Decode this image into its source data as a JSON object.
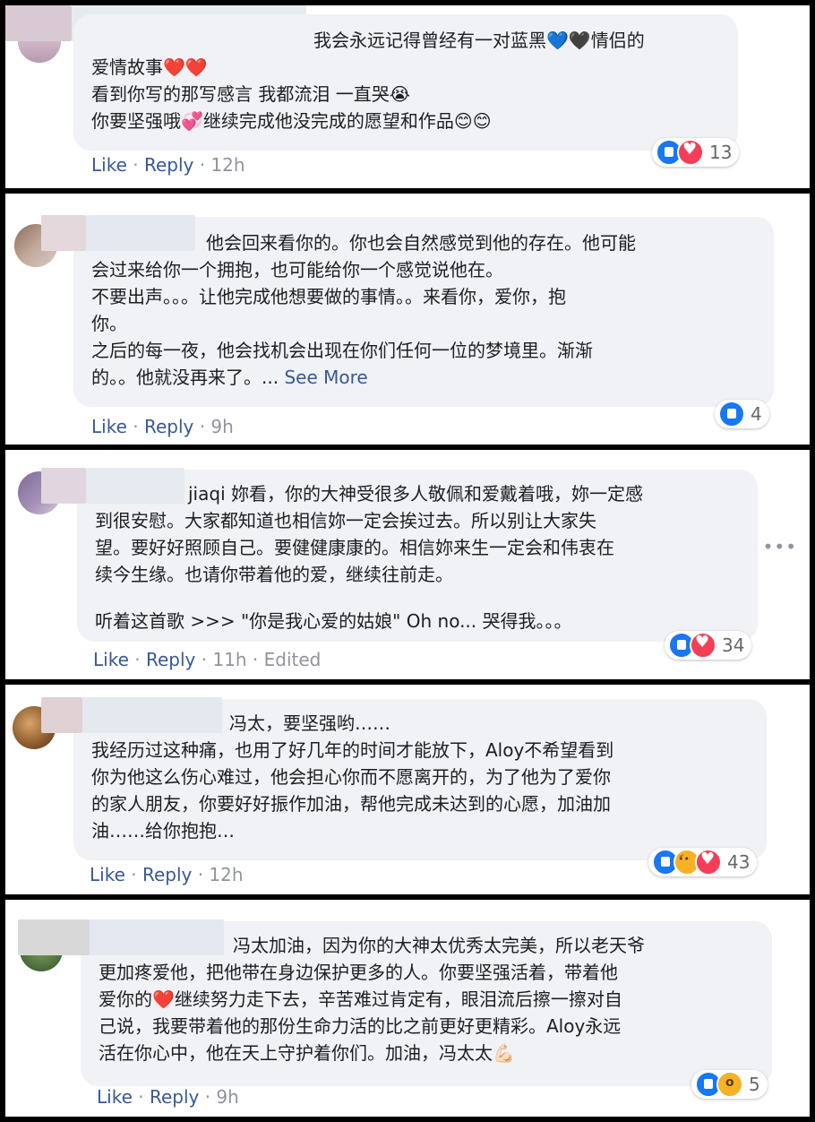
{
  "comments": [
    {
      "lines": [
        "我会永远记得曾经有一对蓝黑💙🖤情侣的",
        "爱情故事❤️❤️",
        "看到你写的那写感言 我都流泪 一直哭😭",
        "你要坚强哦💞继续完成他没完成的愿望和作品😊😊"
      ],
      "like": "Like",
      "sep": "·",
      "reply": "Reply",
      "time": "12h",
      "edited": "",
      "reaction_count": "13"
    },
    {
      "lines": [
        "他会回来看你的。你也会自然感觉到他的存在。他可能",
        "会过来给你一个拥抱，也可能给你一个感觉说他在。",
        "不要出声。。。让他完成他想要做的事情。。来看你，爱你，抱",
        "你。",
        "之后的每一夜，他会找机会出现在你们任何一位的梦境里。渐渐",
        "的。。他就没再来了。..."
      ],
      "see_more": "See More",
      "like": "Like",
      "sep": "·",
      "reply": "Reply",
      "time": "9h",
      "edited": "",
      "reaction_count": "4"
    },
    {
      "lines": [
        "jiaqi 妳看，你的大神受很多人敬佩和爱戴着哦，妳一定感",
        "到很安慰。大家都知道也相信妳一定会挨过去。所以别让大家失",
        "望。要好好照顾自己。要健健康康的。相信妳来生一定会和伟衷在",
        "续今生缘。也请你带着他的爱，继续往前走。",
        "",
        "听着这首歌 >>> \"你是我心爱的姑娘\" Oh no... 哭得我。。。"
      ],
      "like": "Like",
      "sep": "·",
      "reply": "Reply",
      "time": "11h",
      "edited": "Edited",
      "reaction_count": "34",
      "more_dots": "•••"
    },
    {
      "lines": [
        "冯太，要坚强哟……",
        "我经历过这种痛，也用了好几年的时间才能放下，Aloy不希望看到",
        "你为他这么伤心难过，他会担心你而不愿离开的，为了他为了爱你",
        "的家人朋友，你要好好振作加油，帮他完成未达到的心愿，加油加",
        "油……给你抱抱…"
      ],
      "like": "Like",
      "sep": "·",
      "reply": "Reply",
      "time": "12h",
      "edited": "",
      "reaction_count": "43"
    },
    {
      "lines": [
        "冯太加油，因为你的大神太优秀太完美，所以老天爷",
        "更加疼爱他，把他带在身边保护更多的人。你要坚强活着，带着他",
        "爱你的❤️继续努力走下去，辛苦难过肯定有，眼泪流后擦一擦对自",
        "己说，我要带着他的那份生命力活的比之前更好更精彩。Aloy永远",
        "活在你心中，他在天上守护着你们。加油，冯太太💪🏻"
      ],
      "like": "Like",
      "sep": "·",
      "reply": "Reply",
      "time": "9h",
      "edited": "",
      "reaction_count": "5"
    }
  ],
  "colors": {
    "link": "#385898",
    "bubble": "#f0f2f5",
    "like": "#1877f2",
    "love": "#f33e58",
    "haha": "#f7b125"
  },
  "icons": {
    "like": "like-icon",
    "love": "love-icon",
    "sad": "sad-icon",
    "wow": "wow-icon",
    "more": "more-dots-icon"
  }
}
